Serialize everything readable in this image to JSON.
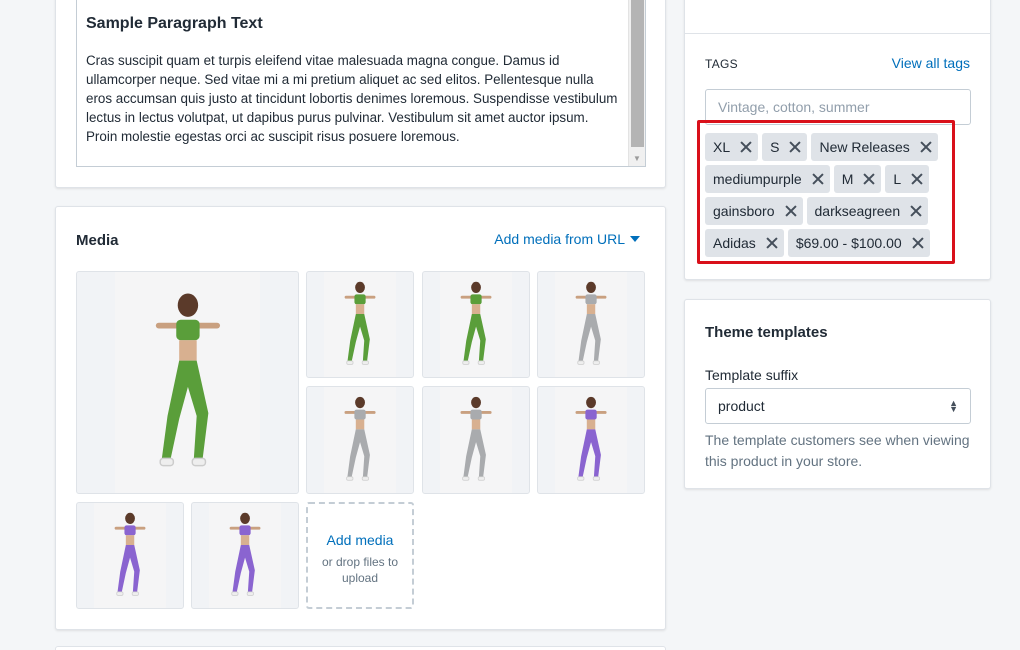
{
  "description": {
    "heading": "Sample Paragraph Text",
    "paragraph": "Cras suscipit quam et turpis eleifend vitae malesuada magna congue. Damus id ullamcorper neque. Sed vitae mi a mi pretium aliquet ac sed elitos. Pellentesque nulla eros accumsan quis justo at tincidunt lobortis denimes loremous. Suspendisse vestibulum lectus in lectus volutpat, ut dapibus purus pulvinar. Vestibulum sit amet auctor ipsum. Proin molestie egestas orci ac suscipit risus posuere loremous."
  },
  "media": {
    "title": "Media",
    "add_from_url": "Add media from URL",
    "add_media": "Add media",
    "drop_files": "or drop files to upload",
    "images": [
      {
        "outfit": "green"
      },
      {
        "outfit": "green"
      },
      {
        "outfit": "green"
      },
      {
        "outfit": "grey"
      },
      {
        "outfit": "grey"
      },
      {
        "outfit": "grey"
      },
      {
        "outfit": "purple"
      },
      {
        "outfit": "purple"
      },
      {
        "outfit": "purple"
      }
    ]
  },
  "tags": {
    "label": "TAGS",
    "view_all": "View all tags",
    "placeholder": "Vintage, cotton, summer",
    "rows": [
      [
        "XL",
        "S",
        "New Releases"
      ],
      [
        "mediumpurple",
        "M",
        "L"
      ],
      [
        "gainsboro",
        "darkseagreen"
      ],
      [
        "Adidas",
        "$69.00 - $100.00"
      ]
    ]
  },
  "theme": {
    "title": "Theme templates",
    "suffix_label": "Template suffix",
    "suffix_value": "product",
    "help": "The template customers see when viewing this product in your store."
  },
  "colors": {
    "link": "#006fbb",
    "highlight": "#d9101a",
    "tag_bg": "#dfe3e8",
    "green": "#5a9e3a",
    "grey": "#a9abae",
    "purple": "#8a64d0"
  }
}
